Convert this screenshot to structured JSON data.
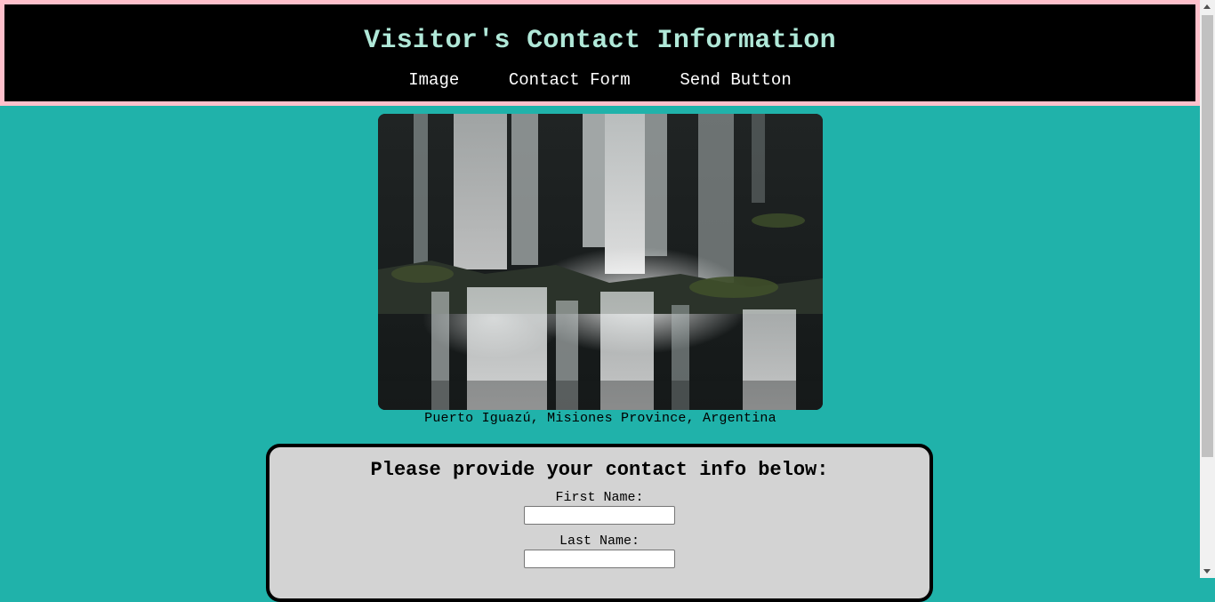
{
  "header": {
    "title": "Visitor's Contact Information",
    "nav": [
      "Image",
      "Contact Form",
      "Send Button"
    ]
  },
  "figure": {
    "caption": "Puerto Iguazú, Misiones Province, Argentina"
  },
  "form": {
    "heading": "Please provide your contact info below:",
    "first_name_label": "First Name:",
    "first_name_value": "",
    "last_name_label": "Last Name:",
    "last_name_value": ""
  },
  "colors": {
    "page_bg": "#20b2aa",
    "header_bg": "#000000",
    "header_border": "#ffc0cb",
    "title": "#b0e8d8",
    "form_bg": "#d3d3d3"
  }
}
